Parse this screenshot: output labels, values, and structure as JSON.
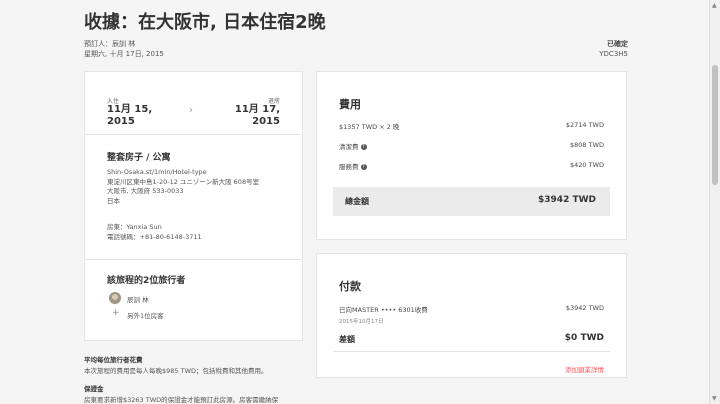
{
  "header": {
    "title": "收據：在大阪市, 日本住宿2晚",
    "booker": "預訂人：辰訓 林",
    "date": "星期六, 十月 17日, 2015",
    "status_label": "已確定",
    "code": "YDC3H5"
  },
  "stay": {
    "checkin_label": "入住",
    "checkin_date_line1": "11月 15,",
    "checkin_date_line2": "2015",
    "checkout_label": "退房",
    "checkout_date_line1": "11月 17,",
    "checkout_date_line2": "2015",
    "room_type": "整套房子 / 公寓",
    "address_lines": [
      "Shin-Osaka.st/1min/Hotel-type",
      "東淀川区東中島1-20-12 ユニゾーン新大阪 608号室",
      "大阪市, 大阪府 533-0033",
      "日本"
    ],
    "host": "房東：Yanxia Sun",
    "phone": "電話號碼：+81-80-6148-3711"
  },
  "travelers": {
    "title": "該旅程的2位旅行者",
    "guest_name": "辰訓 林",
    "more": "另外1位房客"
  },
  "fees": {
    "title": "費用",
    "rows": [
      {
        "label": "$1357 TWD × 2 晚",
        "value": "$2714 TWD"
      },
      {
        "label": "清潔費",
        "value": "$808 TWD"
      },
      {
        "label": "服務費",
        "value": "$420 TWD"
      }
    ],
    "total_label": "總金額",
    "total_value": "$3942 TWD"
  },
  "payment": {
    "title": "付款",
    "row_label": "已向MASTER •••• 6301收費",
    "row_value": "$3942 TWD",
    "row_date": "2015年10月17日",
    "diff_label": "差額",
    "diff_value": "$0 TWD",
    "link": "添加額業詳情"
  },
  "notes": {
    "avg_title": "平均每位旅行者花費",
    "avg_text": "本次旅程的費用是每人每晚$985 TWD；包括稅費和其他費用。",
    "deposit_title": "保證金",
    "deposit_text": "房東要求新增$3263 TWD的保證金才能預訂此房源。房客需繳納保"
  },
  "colors": {
    "accent": "#ff5a5f",
    "total_bg": "#ebebeb"
  }
}
